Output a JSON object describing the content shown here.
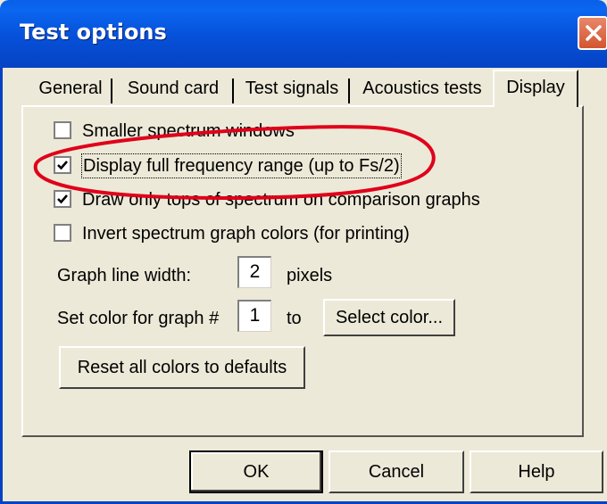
{
  "window": {
    "title": "Test options",
    "close_icon": "close-icon"
  },
  "tabs": [
    {
      "label": "General",
      "active": false
    },
    {
      "label": "Sound card",
      "active": false
    },
    {
      "label": "Test signals",
      "active": false
    },
    {
      "label": "Acoustics tests",
      "active": false
    },
    {
      "label": "Display",
      "active": true
    }
  ],
  "display": {
    "checkboxes": [
      {
        "label": "Smaller spectrum windows",
        "checked": false
      },
      {
        "label": "Display full frequency range (up to Fs/2)",
        "checked": true,
        "focused": true
      },
      {
        "label": "Draw only tops of spectrum on comparison graphs",
        "checked": true
      },
      {
        "label": "Invert spectrum graph colors (for printing)",
        "checked": false
      }
    ],
    "line_width_label": "Graph line width:",
    "line_width_value": "2",
    "line_width_unit": "pixels",
    "color_label": "Set color for graph #",
    "color_graph_value": "1",
    "color_to": "to",
    "select_color_button": "Select color...",
    "reset_colors_button": "Reset all colors to defaults"
  },
  "buttons": {
    "ok": "OK",
    "cancel": "Cancel",
    "help": "Help"
  },
  "annotation": {
    "color": "#e0001a",
    "target": "Display full frequency range (up to Fs/2)"
  }
}
